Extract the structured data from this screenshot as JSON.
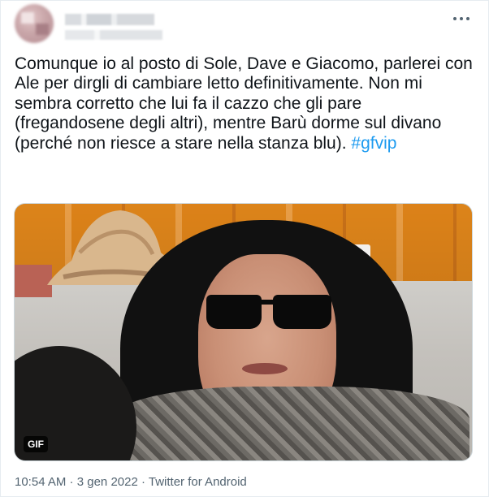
{
  "tweet": {
    "text_before_hashtag": "Comunque io al posto di Sole, Dave e Giacomo, parlerei con Ale per dirgli di cambiare letto definitivamente. Non mi sembra corretto che lui fa il cazzo che gli pare (fregandosene degli altri), mentre Barù dorme sul divano (perché non riesce a stare nella stanza blu). ",
    "hashtag": "#gfvip"
  },
  "media": {
    "badge": "GIF"
  },
  "meta": {
    "time": "10:54 AM",
    "separator": " · ",
    "date": "3 gen 2022",
    "source": "Twitter for Android"
  },
  "colors": {
    "text": "#0f1419",
    "secondary": "#536471",
    "link": "#1d9bf0"
  },
  "icons": {
    "more": "more-horizontal-icon"
  }
}
